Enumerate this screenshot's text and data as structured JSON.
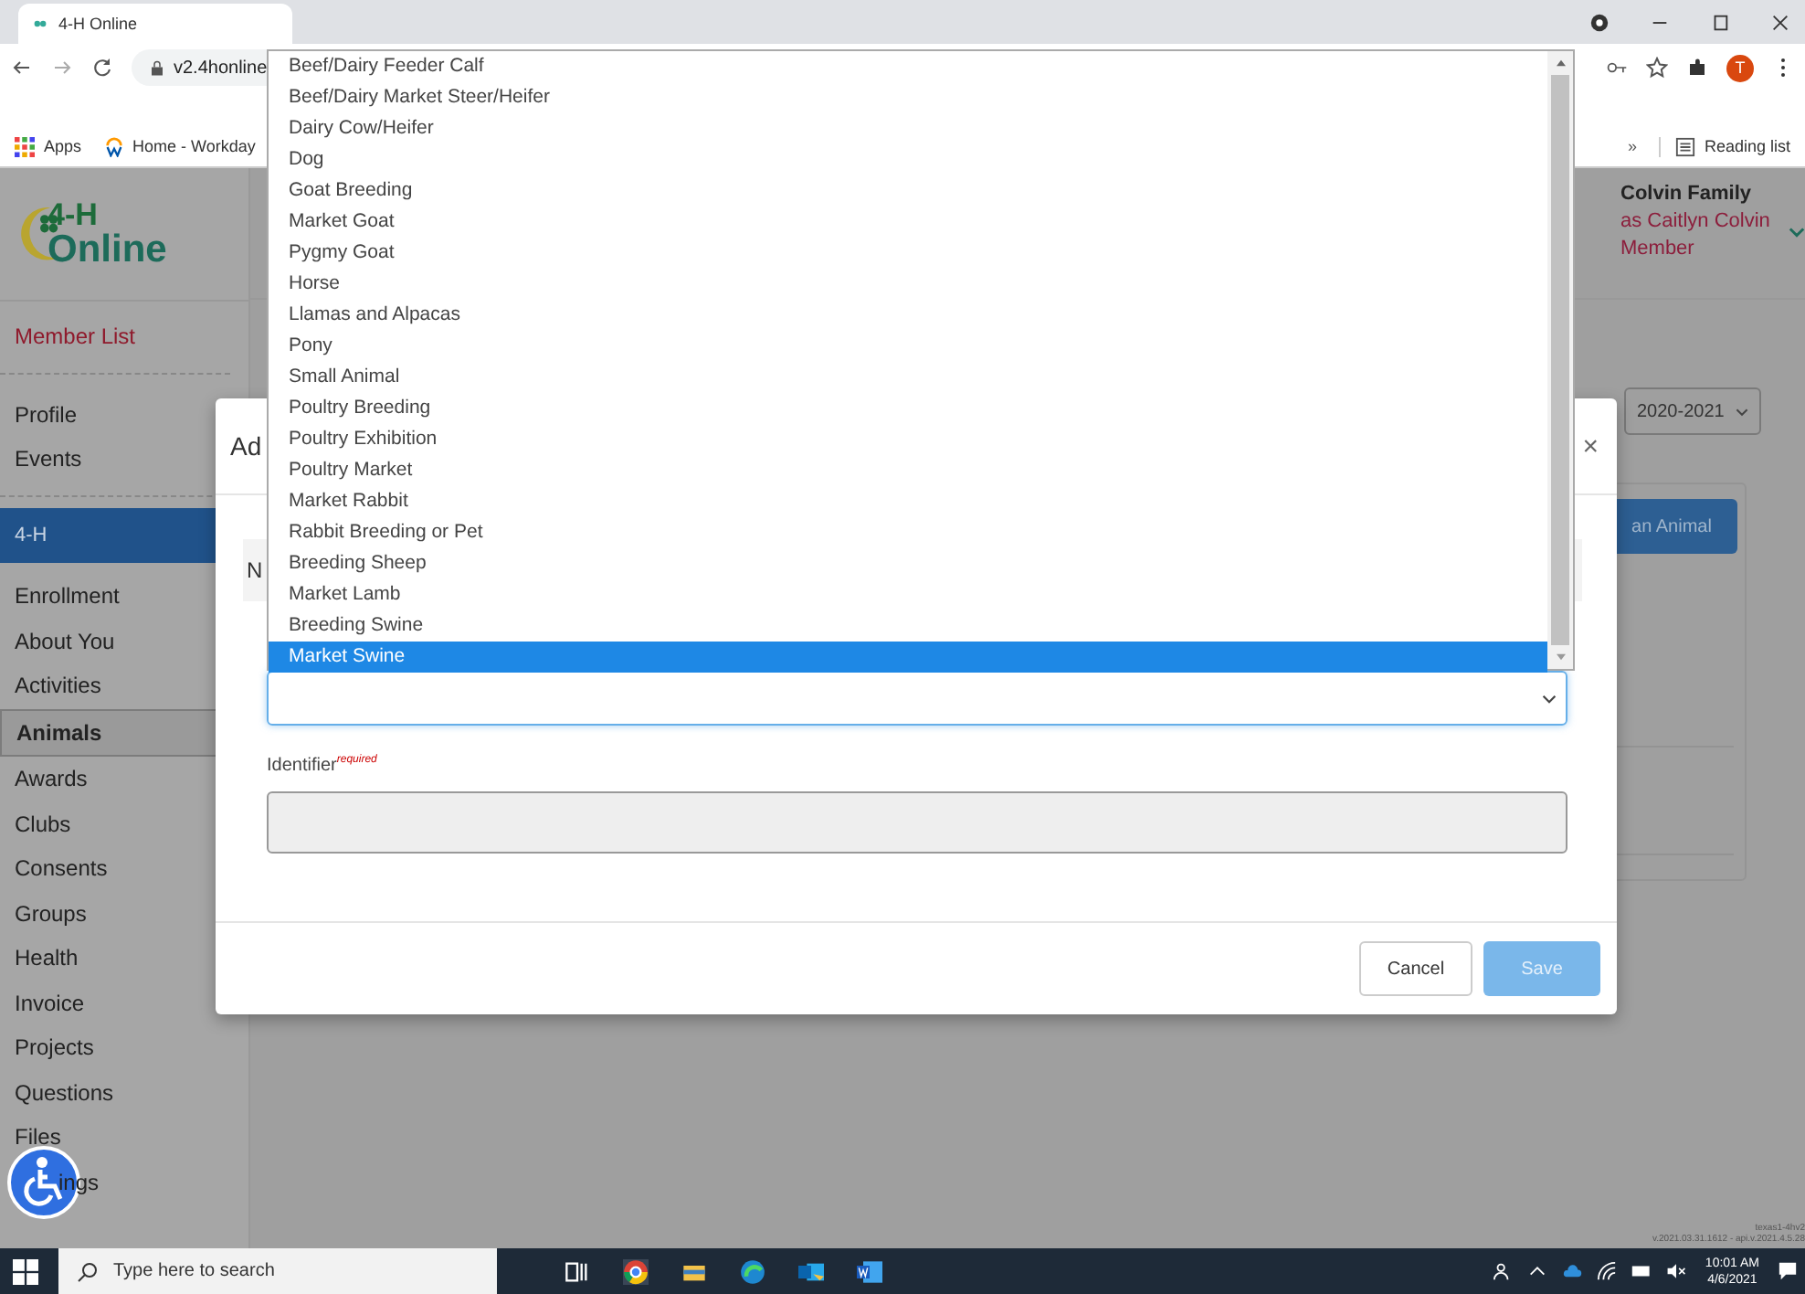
{
  "browser": {
    "tab_title": "4-H Online",
    "address": "v2.4honline",
    "avatar_letter": "T",
    "bookmarks": [
      {
        "label": "Apps"
      },
      {
        "label": "Home - Workday"
      }
    ],
    "more": "»",
    "reading_list": "Reading list"
  },
  "sidebar": {
    "logo_line1": "4-H",
    "logo_line2": "Online",
    "items": [
      {
        "label": "Member List",
        "kind": "top",
        "selected": false
      },
      {
        "label": "Profile",
        "kind": "link",
        "selected": false
      },
      {
        "label": "Events",
        "kind": "link",
        "selected": false
      },
      {
        "label": "4-H",
        "kind": "section",
        "selected": false
      },
      {
        "label": "Enrollment",
        "kind": "link",
        "selected": false
      },
      {
        "label": "About You",
        "kind": "link",
        "selected": false
      },
      {
        "label": "Activities",
        "kind": "link",
        "selected": false
      },
      {
        "label": "Animals",
        "kind": "link",
        "selected": true
      },
      {
        "label": "Awards",
        "kind": "link",
        "selected": false
      },
      {
        "label": "Clubs",
        "kind": "link",
        "selected": false
      },
      {
        "label": "Consents",
        "kind": "link",
        "selected": false
      },
      {
        "label": "Groups",
        "kind": "link",
        "selected": false
      },
      {
        "label": "Health",
        "kind": "link",
        "selected": false
      },
      {
        "label": "Invoice",
        "kind": "link",
        "selected": false
      },
      {
        "label": "Projects",
        "kind": "link",
        "selected": false
      },
      {
        "label": "Questions",
        "kind": "link",
        "selected": false
      },
      {
        "label": "Files",
        "kind": "link",
        "selected": false
      },
      {
        "label": "ings",
        "kind": "link",
        "selected": false
      }
    ]
  },
  "user": {
    "family": "Colvin Family",
    "as": "as Caitlyn Colvin",
    "role": "Member"
  },
  "year_select": {
    "value": "2020-2021"
  },
  "add_button": "an Animal",
  "modal": {
    "title": "Ad",
    "tab_label": "N",
    "identifier_label": "Identifier",
    "required": "required",
    "cancel": "Cancel",
    "save": "Save",
    "close": "×"
  },
  "dropdown": {
    "options": [
      {
        "label": "Beef/Dairy Feeder Calf",
        "selected": false
      },
      {
        "label": "Beef/Dairy Market Steer/Heifer",
        "selected": false
      },
      {
        "label": "Dairy Cow/Heifer",
        "selected": false
      },
      {
        "label": "Dog",
        "selected": false
      },
      {
        "label": "Goat Breeding",
        "selected": false
      },
      {
        "label": "Market Goat",
        "selected": false
      },
      {
        "label": "Pygmy Goat",
        "selected": false
      },
      {
        "label": "Horse",
        "selected": false
      },
      {
        "label": "Llamas and Alpacas",
        "selected": false
      },
      {
        "label": "Pony",
        "selected": false
      },
      {
        "label": "Small Animal",
        "selected": false
      },
      {
        "label": "Poultry Breeding",
        "selected": false
      },
      {
        "label": "Poultry Exhibition",
        "selected": false
      },
      {
        "label": "Poultry Market",
        "selected": false
      },
      {
        "label": "Market Rabbit",
        "selected": false
      },
      {
        "label": "Rabbit Breeding or Pet",
        "selected": false
      },
      {
        "label": "Breeding Sheep",
        "selected": false
      },
      {
        "label": "Market Lamb",
        "selected": false
      },
      {
        "label": "Breeding Swine",
        "selected": false
      },
      {
        "label": "Market Swine",
        "selected": true
      }
    ]
  },
  "footer": {
    "server": "texas1-4hv2",
    "version": "v.2021.03.31.1612 - api.v.2021.4.5.28"
  },
  "taskbar": {
    "search_placeholder": "Type here to search",
    "time": "10:01 AM",
    "date": "4/6/2021"
  }
}
